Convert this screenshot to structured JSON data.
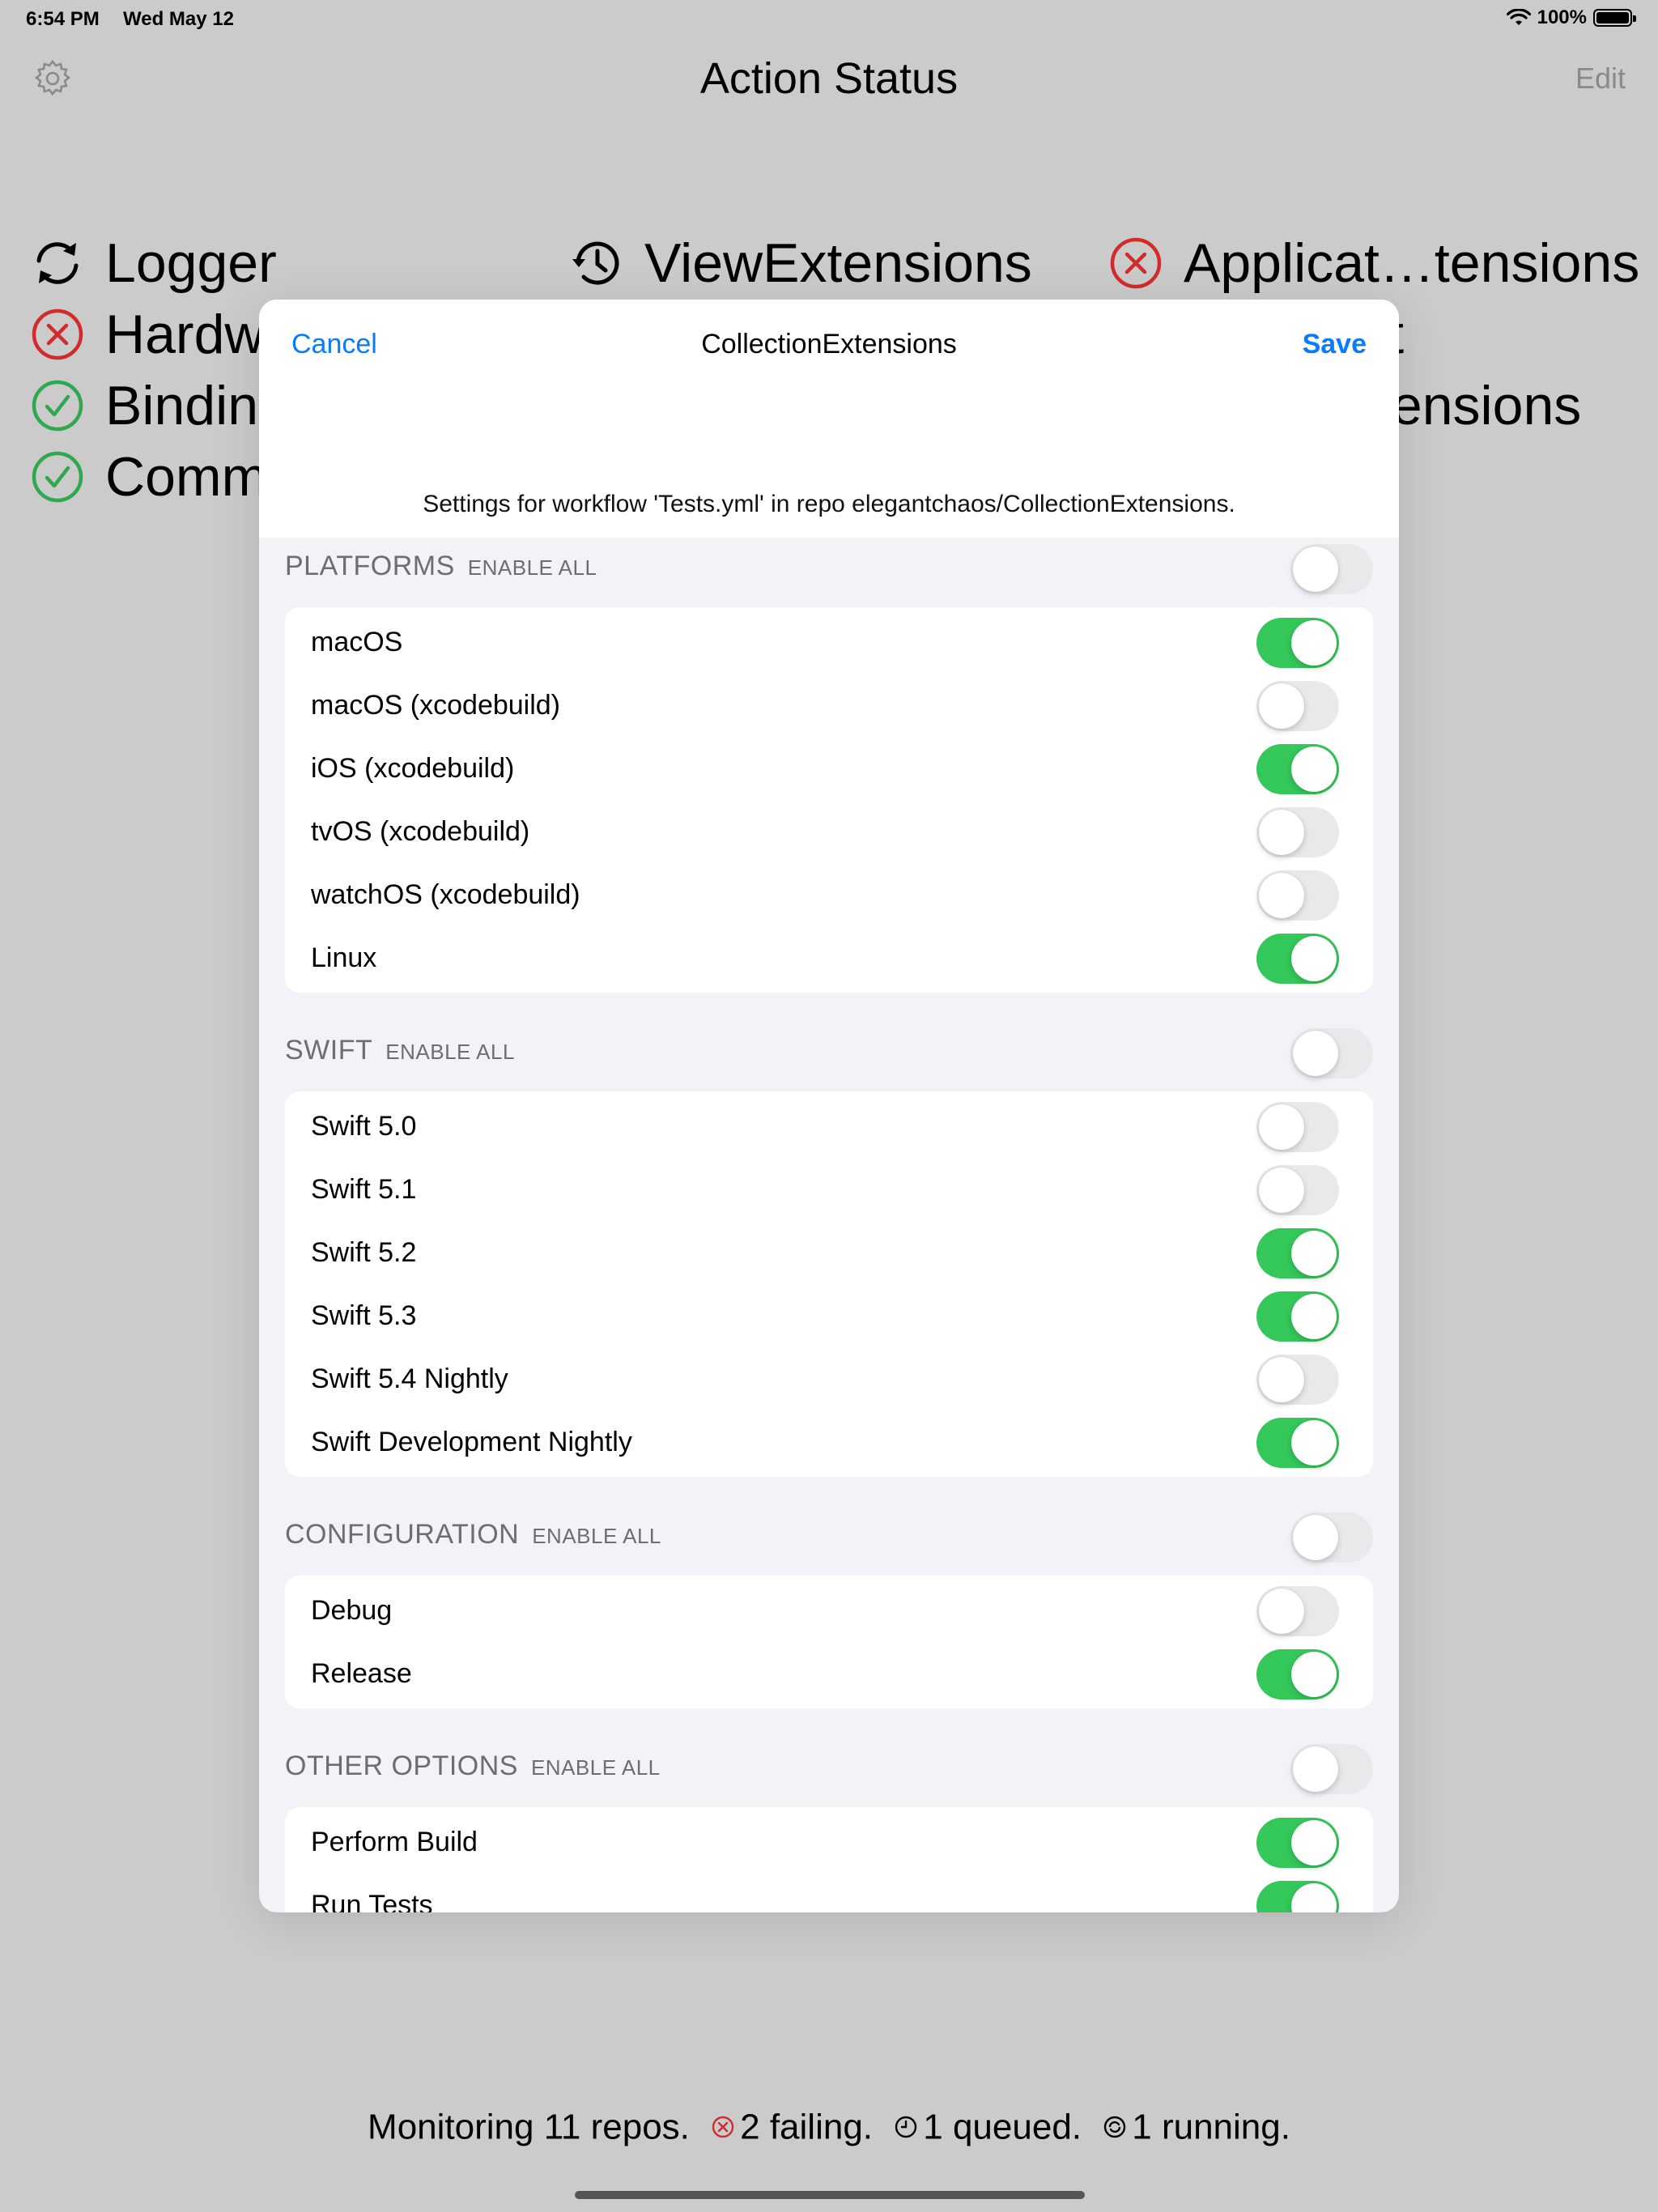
{
  "status_bar": {
    "time": "6:54 PM",
    "date": "Wed May 12",
    "battery": "100%"
  },
  "nav": {
    "title": "Action Status",
    "edit": "Edit"
  },
  "repos": [
    {
      "name": "Logger",
      "status": "running"
    },
    {
      "name": "ViewExtensions",
      "status": "queued"
    },
    {
      "name": "Applicat…tensions",
      "status": "failing"
    },
    {
      "name": "Hardw",
      "status": "failing"
    },
    {
      "name": "it",
      "status": "hidden"
    },
    {
      "name": "Binding",
      "status": "passing"
    },
    {
      "name": "tensions",
      "status": "hidden"
    },
    {
      "name": "Comm",
      "status": "passing"
    }
  ],
  "footer": {
    "monitoring": "Monitoring 11 repos.",
    "failing": "2 failing.",
    "queued": "1 queued.",
    "running": "1 running."
  },
  "sheet": {
    "cancel": "Cancel",
    "title": "CollectionExtensions",
    "save": "Save",
    "description": "Settings for workflow 'Tests.yml' in repo elegantchaos/CollectionExtensions.",
    "enable_all": "ENABLE ALL",
    "sections": [
      {
        "title": "PLATFORMS",
        "enable_all_on": false,
        "items": [
          {
            "label": "macOS",
            "on": true
          },
          {
            "label": "macOS (xcodebuild)",
            "on": false
          },
          {
            "label": "iOS (xcodebuild)",
            "on": true
          },
          {
            "label": "tvOS (xcodebuild)",
            "on": false
          },
          {
            "label": "watchOS (xcodebuild)",
            "on": false
          },
          {
            "label": "Linux",
            "on": true
          }
        ]
      },
      {
        "title": "SWIFT",
        "enable_all_on": false,
        "items": [
          {
            "label": "Swift 5.0",
            "on": false
          },
          {
            "label": "Swift 5.1",
            "on": false
          },
          {
            "label": "Swift 5.2",
            "on": true
          },
          {
            "label": "Swift 5.3",
            "on": true
          },
          {
            "label": "Swift 5.4 Nightly",
            "on": false
          },
          {
            "label": "Swift Development Nightly",
            "on": true
          }
        ]
      },
      {
        "title": "CONFIGURATION",
        "enable_all_on": false,
        "items": [
          {
            "label": "Debug",
            "on": false
          },
          {
            "label": "Release",
            "on": true
          }
        ]
      },
      {
        "title": "OTHER OPTIONS",
        "enable_all_on": false,
        "items": [
          {
            "label": "Perform Build",
            "on": true
          },
          {
            "label": "Run Tests",
            "on": true
          }
        ]
      }
    ]
  },
  "colors": {
    "accent": "#0a7aff",
    "toggle_on": "#34c759",
    "toggle_off": "#e9e9eb",
    "failing": "#d12b2b",
    "passing": "#2fa84f",
    "dim_background": "#cbcbcb"
  },
  "icons": {
    "settings": "gear-icon",
    "running": "sync-icon",
    "queued": "history-clock-icon",
    "failing": "x-circle-icon",
    "passing": "check-circle-icon"
  }
}
